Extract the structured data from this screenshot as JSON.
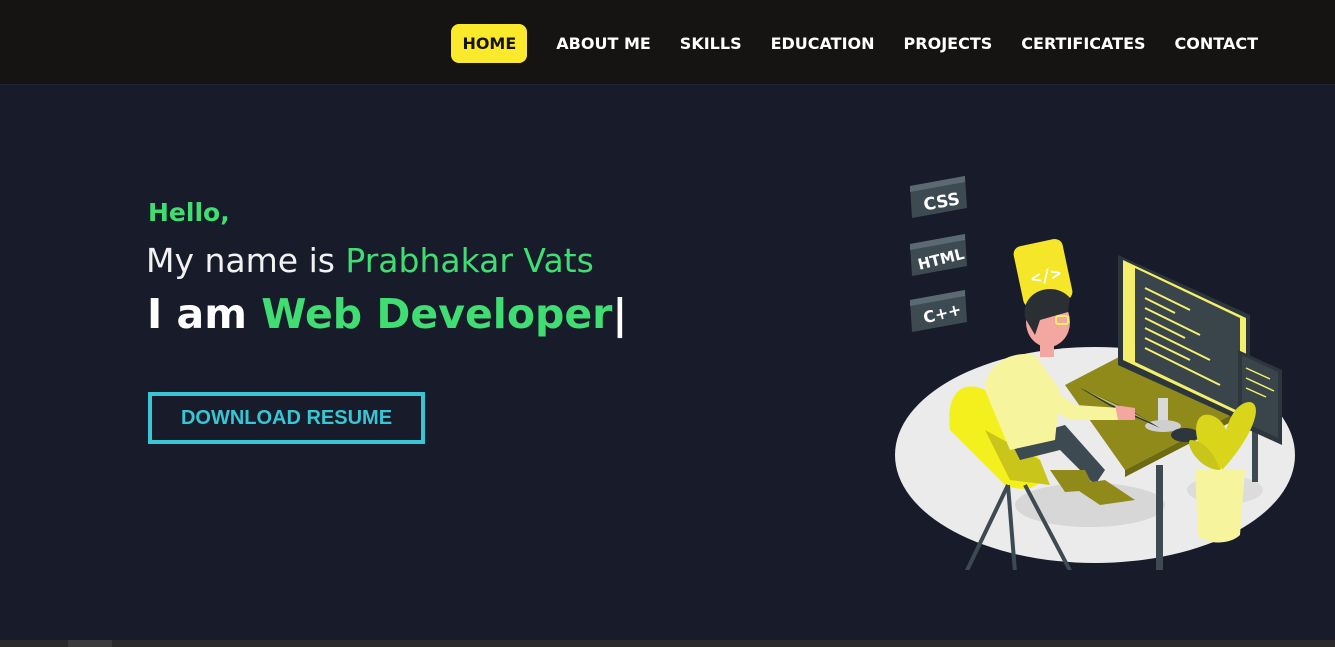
{
  "nav": {
    "items": [
      {
        "label": "HOME",
        "active": true
      },
      {
        "label": "ABOUT ME",
        "active": false
      },
      {
        "label": "SKILLS",
        "active": false
      },
      {
        "label": "EDUCATION",
        "active": false
      },
      {
        "label": "PROJECTS",
        "active": false
      },
      {
        "label": "CERTIFICATES",
        "active": false
      },
      {
        "label": "CONTACT",
        "active": false
      }
    ]
  },
  "hero": {
    "greeting": "Hello,",
    "name_prefix": "My name is ",
    "name": "Prabhakar Vats",
    "role_prefix": "I am ",
    "role": "Web Developer",
    "cursor": "|",
    "resume_button": "DOWNLOAD RESUME"
  },
  "illustration": {
    "tags": [
      "CSS",
      "HTML",
      "C++"
    ],
    "code_bubble": "</>"
  },
  "colors": {
    "background": "#181b29",
    "navbar": "#161412",
    "accent_green": "#3fdd72",
    "accent_yellow": "#fbe92b",
    "button_cyan": "#38c6d4"
  }
}
